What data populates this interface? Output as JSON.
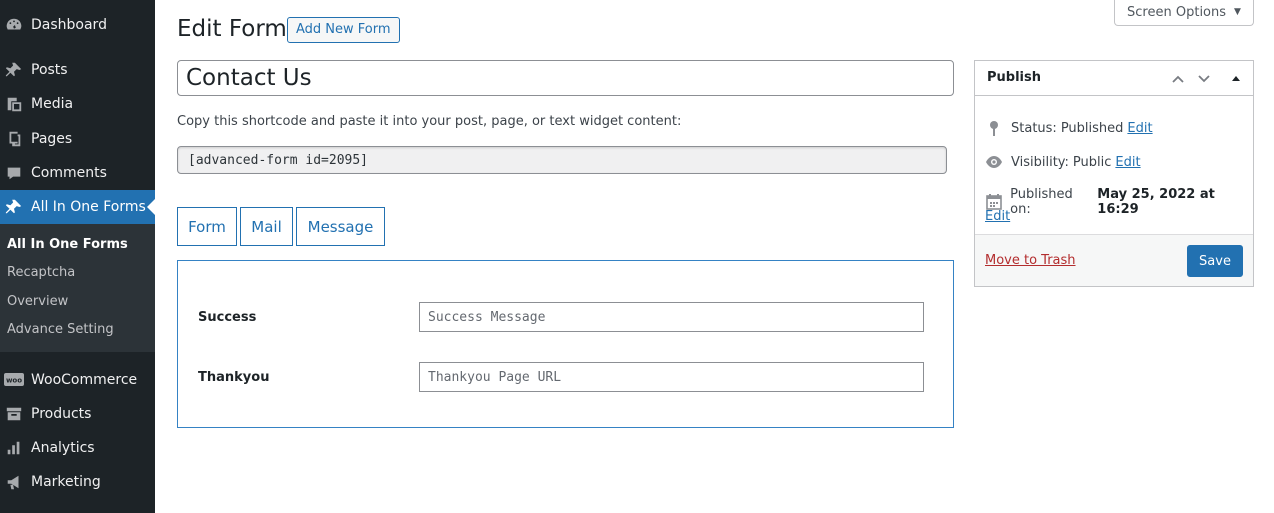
{
  "sidebar": {
    "items": [
      {
        "label": "Dashboard",
        "icon": "dashboard-icon"
      },
      {
        "label": "Posts",
        "icon": "pin-icon"
      },
      {
        "label": "Media",
        "icon": "media-icon"
      },
      {
        "label": "Pages",
        "icon": "pages-icon"
      },
      {
        "label": "Comments",
        "icon": "comment-icon"
      },
      {
        "label": "All In One Forms",
        "icon": "pin-icon"
      },
      {
        "label": "WooCommerce",
        "icon": "woocommerce-icon"
      },
      {
        "label": "Products",
        "icon": "archive-icon"
      },
      {
        "label": "Analytics",
        "icon": "bar-chart-icon"
      },
      {
        "label": "Marketing",
        "icon": "megaphone-icon"
      }
    ],
    "active_item": "All In One Forms",
    "submenu": [
      "All In One Forms",
      "Recaptcha",
      "Overview",
      "Advance Setting"
    ],
    "submenu_current": "All In One Forms"
  },
  "header": {
    "title": "Edit Form",
    "add_new_label": "Add New Form",
    "screen_options_label": "Screen Options"
  },
  "form": {
    "title_value": "Contact Us",
    "shortcode_hint": "Copy this shortcode and paste it into your post, page, or text widget content:",
    "shortcode_value": "[advanced-form id=2095]"
  },
  "tabs": [
    {
      "label": "Form"
    },
    {
      "label": "Mail"
    },
    {
      "label": "Message"
    }
  ],
  "message_panel": {
    "rows": [
      {
        "label": "Success",
        "placeholder": "Success Message"
      },
      {
        "label": "Thankyou",
        "placeholder": "Thankyou Page URL"
      }
    ]
  },
  "publish": {
    "title": "Publish",
    "status_label": "Status: ",
    "status_value": "Published",
    "visibility_label": "Visibility: ",
    "visibility_value": "Public",
    "published_on_label": "Published on: ",
    "published_on_value": "May 25, 2022 at 16:29",
    "edit_label": "Edit",
    "trash_label": "Move to Trash",
    "save_label": "Save"
  },
  "colors": {
    "sidebar_bg": "#1d2327",
    "submenu_bg": "#2c3338",
    "accent": "#2271b1",
    "trash": "#b32d2e"
  }
}
